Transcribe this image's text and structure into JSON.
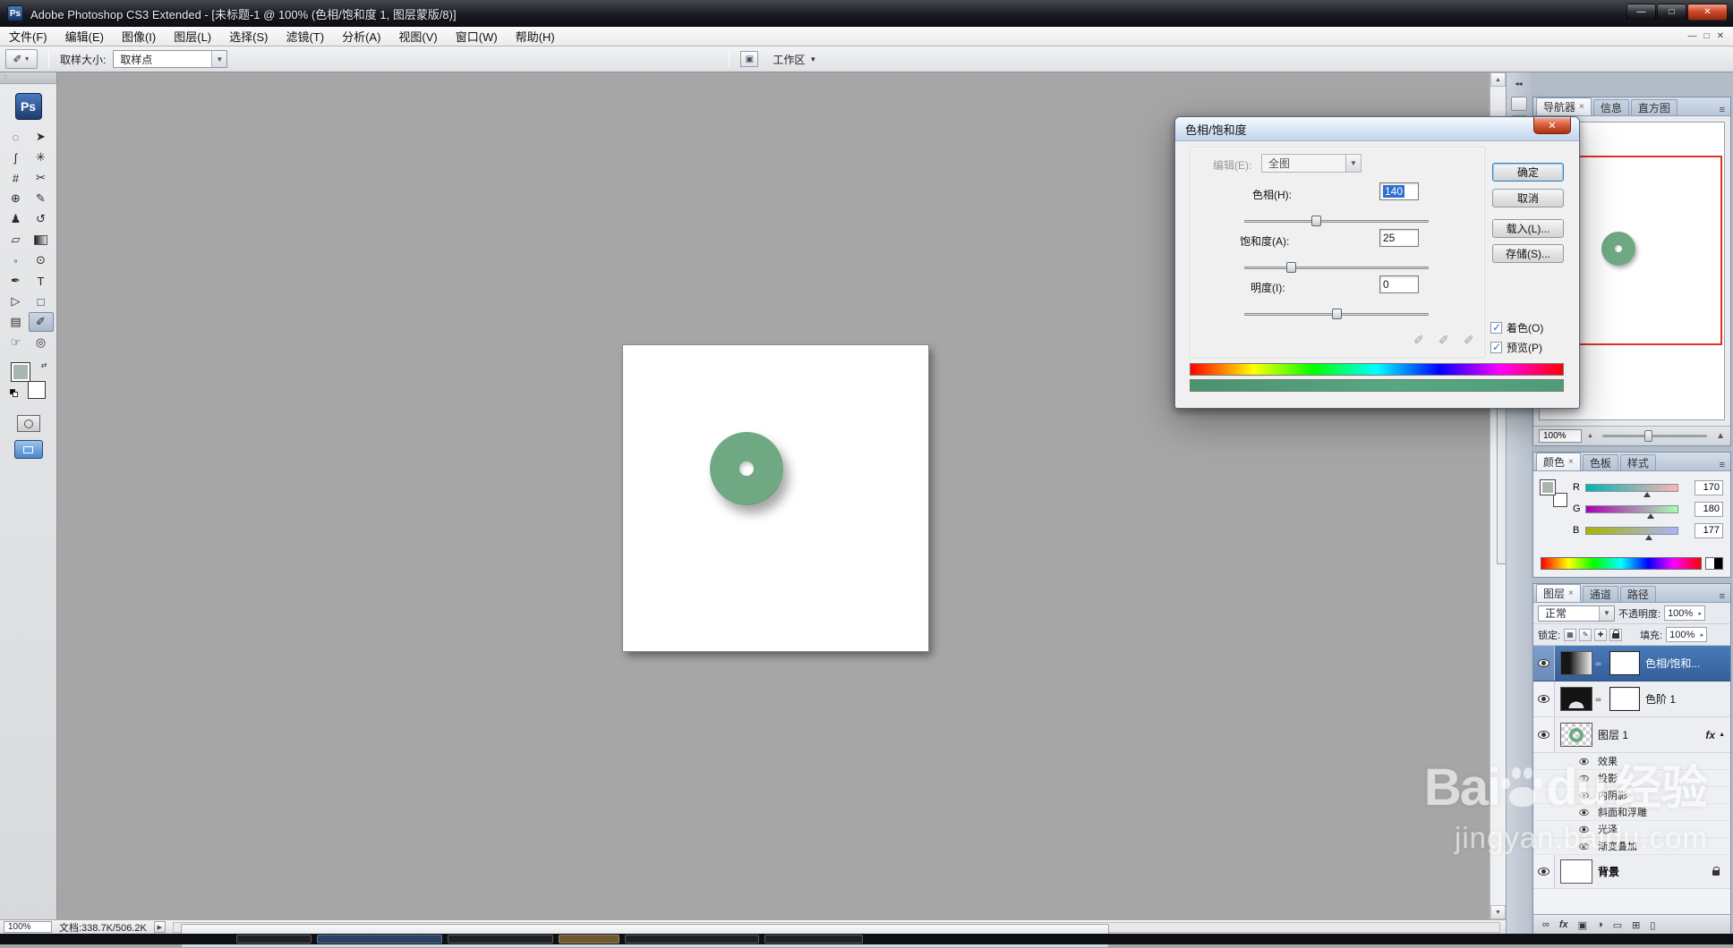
{
  "titlebar": {
    "app_icon_label": "Ps",
    "title": "Adobe Photoshop CS3 Extended - [未标题-1 @ 100% (色相/饱和度 1, 图层蒙版/8)]",
    "minimize_glyph": "—",
    "maximize_glyph": "□",
    "close_glyph": "✕"
  },
  "menubar": {
    "items": [
      "文件(F)",
      "编辑(E)",
      "图像(I)",
      "图层(L)",
      "选择(S)",
      "滤镜(T)",
      "分析(A)",
      "视图(V)",
      "窗口(W)",
      "帮助(H)"
    ],
    "doc_minimize_glyph": "—",
    "doc_restore_glyph": "□",
    "doc_close_glyph": "✕"
  },
  "options_bar": {
    "tool_icon_glyph": "✐",
    "dropdown_glyph": "▼",
    "sample_size_label": "取样大小:",
    "sample_size_value": "取样点",
    "workspace_icon_glyph": "▣",
    "workspace_label": "工作区",
    "workspace_arrow": "▼"
  },
  "toolbox": {
    "logo": "Ps",
    "tools": [
      {
        "name": "elliptical-marquee-tool",
        "glyph": "◌"
      },
      {
        "name": "move-tool",
        "glyph": "➤"
      },
      {
        "name": "lasso-tool",
        "glyph": "ʃ"
      },
      {
        "name": "magic-wand-tool",
        "glyph": "✳"
      },
      {
        "name": "crop-tool",
        "glyph": "#"
      },
      {
        "name": "slice-tool",
        "glyph": "✂"
      },
      {
        "name": "healing-brush-tool",
        "glyph": "⊕"
      },
      {
        "name": "brush-tool",
        "glyph": "✎"
      },
      {
        "name": "clone-stamp-tool",
        "glyph": "♟"
      },
      {
        "name": "history-brush-tool",
        "glyph": "↺"
      },
      {
        "name": "eraser-tool",
        "glyph": "▱"
      },
      {
        "name": "gradient-tool",
        "glyph": ""
      },
      {
        "name": "blur-tool",
        "glyph": "◦"
      },
      {
        "name": "dodge-tool",
        "glyph": "⊙"
      },
      {
        "name": "pen-tool",
        "glyph": "✒"
      },
      {
        "name": "type-tool",
        "glyph": "T"
      },
      {
        "name": "path-selection-tool",
        "glyph": "▷"
      },
      {
        "name": "shape-tool",
        "glyph": "□"
      },
      {
        "name": "notes-tool",
        "glyph": "▤"
      },
      {
        "name": "eyedropper-tool",
        "glyph": "✐"
      },
      {
        "name": "hand-tool",
        "glyph": "☞"
      },
      {
        "name": "zoom-tool",
        "glyph": "◎"
      }
    ]
  },
  "dialog": {
    "title": "色相/饱和度",
    "close_glyph": "✕",
    "edit_label": "编辑(E):",
    "edit_value": "全图",
    "dropdown_glyph": "▼",
    "hue": {
      "label": "色相(H):",
      "value": "140",
      "thumb_style": "left:39%"
    },
    "saturation": {
      "label": "饱和度(A):",
      "value": "25",
      "thumb_style": "left:25%"
    },
    "lightness": {
      "label": "明度(I):",
      "value": "0",
      "thumb_style": "left:50%"
    },
    "ok": "确定",
    "cancel": "取消",
    "load": "载入(L)...",
    "save": "存储(S)...",
    "colorize_label": "着色(O)",
    "preview_label": "预览(P)",
    "droppers": [
      "✐",
      "✐",
      "✐"
    ]
  },
  "navigator": {
    "tabs": [
      "导航器",
      "信息",
      "直方图"
    ],
    "tab_close_glyph": "×",
    "zoom": "100%",
    "mountain_glyph": "▲"
  },
  "color_panel": {
    "tabs": [
      "颜色",
      "色板",
      "样式"
    ],
    "tab_close_glyph": "×",
    "channels": [
      {
        "label": "R",
        "value": "170",
        "thumb_style": "left:67%",
        "slider_style": "background:linear-gradient(90deg, rgb(0,180,177), rgb(255,180,177))"
      },
      {
        "label": "G",
        "value": "180",
        "thumb_style": "left:71%",
        "slider_style": "background:linear-gradient(90deg, rgb(170,0,177), rgb(170,255,177))"
      },
      {
        "label": "B",
        "value": "177",
        "thumb_style": "left:69%",
        "slider_style": "background:linear-gradient(90deg, rgb(170,180,0), rgb(170,180,255))"
      }
    ]
  },
  "layers_panel": {
    "tabs": [
      "图层",
      "通道",
      "路径"
    ],
    "tab_close_glyph": "×",
    "blend_mode": "正常",
    "dropdown_glyph": "▼",
    "spinner_glyph": "▸",
    "opacity_label": "不透明度:",
    "opacity_value": "100%",
    "lock_label": "锁定:",
    "fill_label": "填充:",
    "fill_value": "100%",
    "layer_hue_sat": "色相/饱和...",
    "layer_levels": "色阶 1",
    "layer_1": "图层 1",
    "fx_badge": "fx",
    "fx_collapse_glyph": "▲",
    "effects_header": "效果",
    "effects": [
      "投影",
      "内阴影",
      "斜面和浮雕",
      "光泽",
      "渐变叠加"
    ],
    "background_layer": "背景",
    "footer_icons": [
      "∞",
      "fx",
      "▣",
      "◑",
      "▭",
      "⊞",
      "▯"
    ]
  },
  "panel_ui": {
    "menu_glyph": "≡",
    "dock_expand_glyph": "◂◂",
    "scroll_up_glyph": "▲",
    "scroll_down_glyph": "▼"
  },
  "status_bar": {
    "zoom": "100%",
    "doc_info": "文档:338.7K/506.2K",
    "flyout_glyph": "▶"
  },
  "watermark": {
    "brand_left": "Bai",
    "brand_right": "du",
    "brand_cn": "经验",
    "url": "jingyan.baidu.com"
  },
  "colors": {
    "ring_green": "#6fa983",
    "selection_blue": "#3a6aa8",
    "canvas_gray": "#a6a6a6",
    "close_red": "#d24a2b"
  }
}
